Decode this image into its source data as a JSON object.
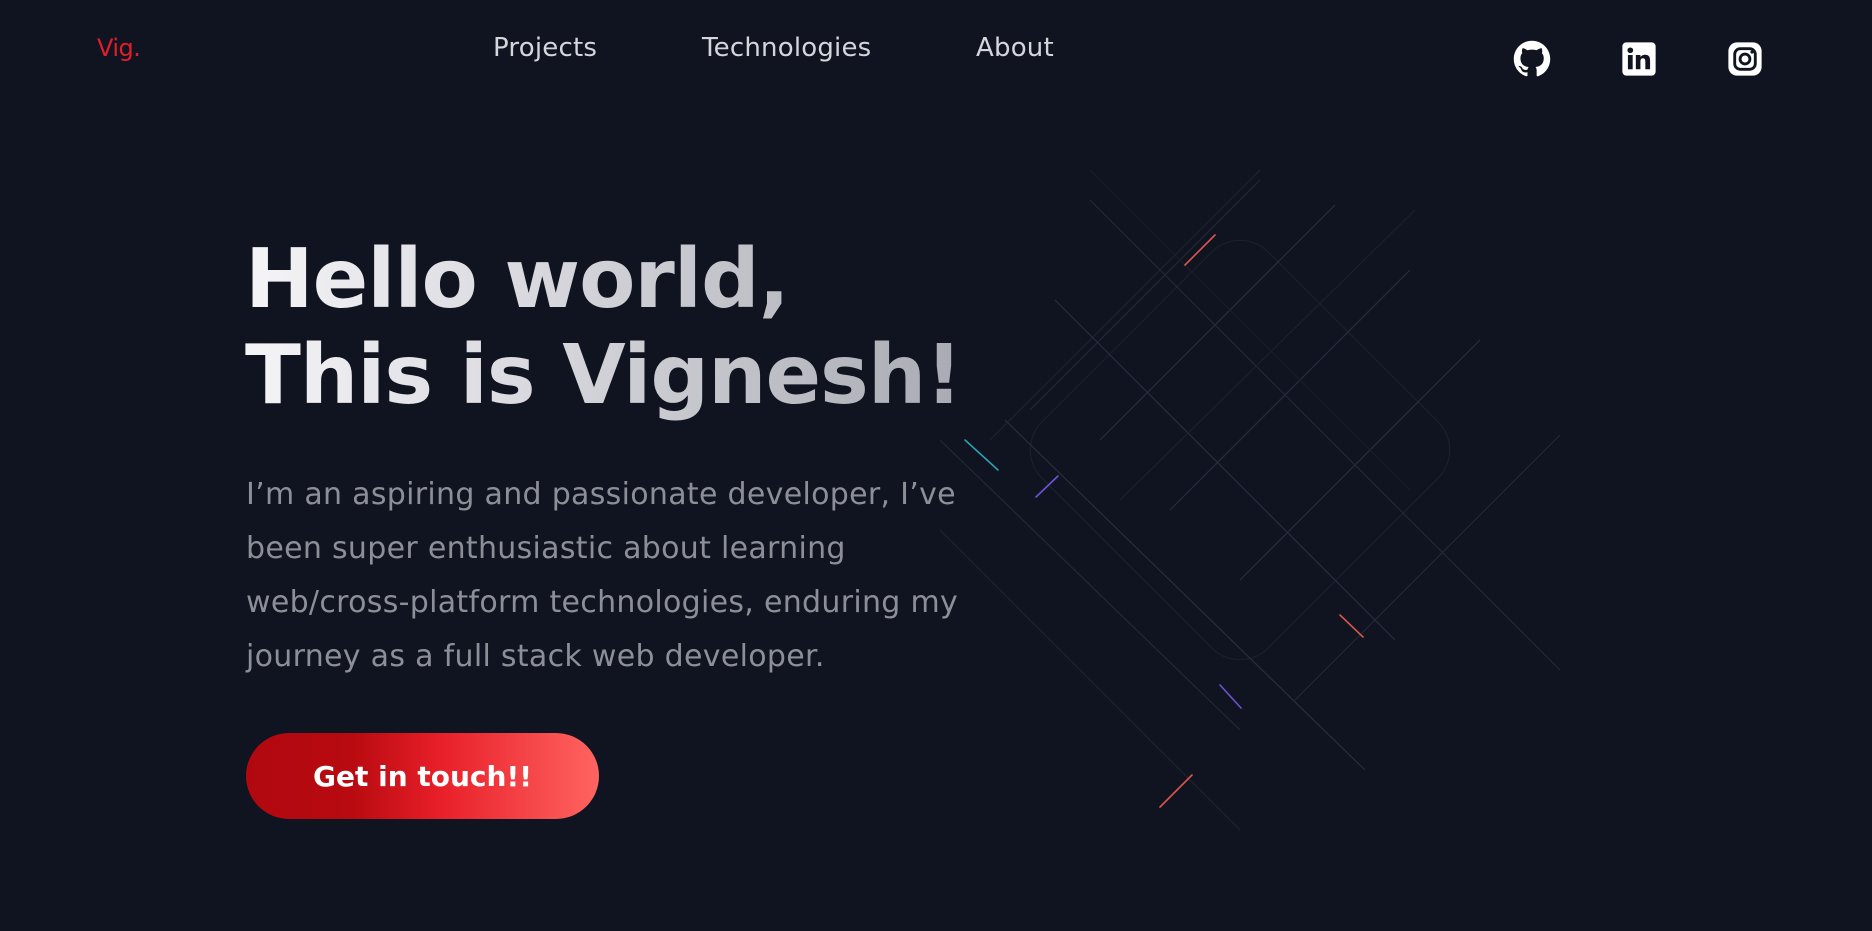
{
  "header": {
    "logo": "Vig.",
    "nav": [
      {
        "label": "Projects"
      },
      {
        "label": "Technologies"
      },
      {
        "label": "About"
      }
    ],
    "social": [
      {
        "icon": "github-icon"
      },
      {
        "icon": "linkedin-icon"
      },
      {
        "icon": "instagram-icon"
      }
    ]
  },
  "hero": {
    "title_line1": "Hello world,",
    "title_line2": "This is Vignesh!",
    "description": "I’m an aspiring and passionate developer, I’ve been super enthusiastic about learning web/cross-platform technologies, enduring my journey as a full stack web developer.",
    "cta_label": "Get in touch!!"
  },
  "colors": {
    "background": "#0f1420",
    "accent": "#e01e2a",
    "cta_gradient_start": "#b10810",
    "cta_gradient_end": "#ff6461",
    "nav_text": "#d4d6dc",
    "body_text": "#8c8f97"
  }
}
